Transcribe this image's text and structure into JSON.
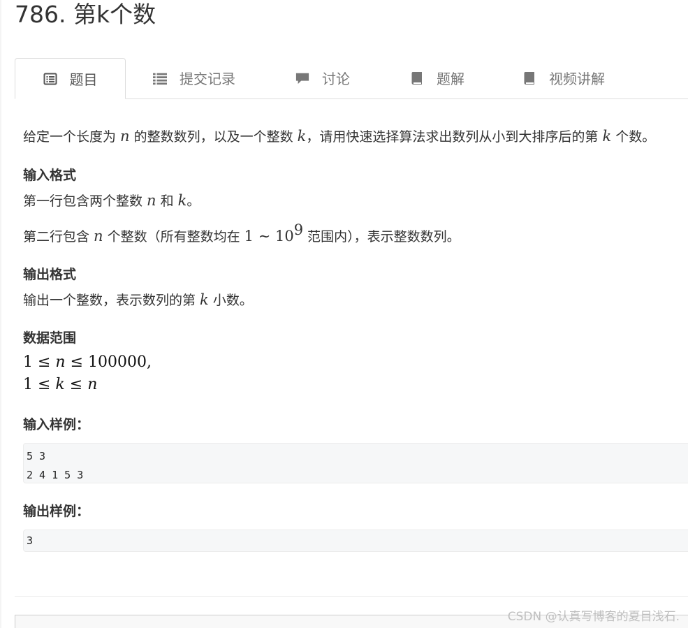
{
  "page": {
    "title": "786. 第k个数"
  },
  "tabs": [
    {
      "label": "题目",
      "icon": "list-alt-icon",
      "active": true
    },
    {
      "label": "提交记录",
      "icon": "list-icon"
    },
    {
      "label": "讨论",
      "icon": "comment-icon"
    },
    {
      "label": "题解",
      "icon": "book-icon"
    },
    {
      "label": "视频讲解",
      "icon": "book-icon"
    }
  ],
  "problem": {
    "desc_pre": "给定一个长度为 ",
    "desc_n": "n",
    "desc_mid": " 的整数数列，以及一个整数 ",
    "desc_k": "k",
    "desc_post": "，请用快速选择算法求出数列从小到大排序后的第 ",
    "desc_k2": "k",
    "desc_end": " 个数。",
    "input_heading": "输入格式",
    "input_line1_pre": "第一行包含两个整数 ",
    "input_line1_n": "n",
    "input_line1_mid": " 和 ",
    "input_line1_k": "k",
    "input_line1_end": "。",
    "input_line2_pre": "第二行包含 ",
    "input_line2_n": "n",
    "input_line2_mid": " 个整数（所有整数均在 ",
    "input_line2_range": "1 ∼ 10",
    "input_line2_exp": "9",
    "input_line2_end": " 范围内），表示整数数列。",
    "output_heading": "输出格式",
    "output_pre": "输出一个整数，表示数列的第 ",
    "output_k": "k",
    "output_end": " 小数。",
    "range_heading": "数据范围",
    "range_line1_a": "1 ≤ ",
    "range_line1_v": "n",
    "range_line1_b": " ≤ 100000,",
    "range_line2_a": "1 ≤ ",
    "range_line2_v": "k",
    "range_line2_b": " ≤ ",
    "range_line2_c": "n",
    "sample_in_heading": "输入样例：",
    "sample_in": "5 3\n2 4 1 5 3",
    "sample_out_heading": "输出样例：",
    "sample_out": "3"
  },
  "watermark": "CSDN @认真写博客的夏目浅石.",
  "colors": {
    "text": "#333333",
    "tab_inactive": "#777777",
    "code_bg": "#f6f7f8",
    "border": "#dddddd"
  }
}
